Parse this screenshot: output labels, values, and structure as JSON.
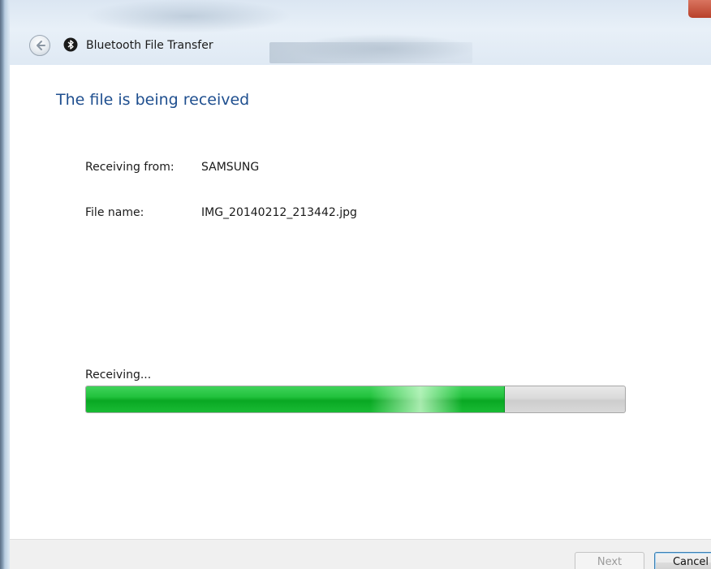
{
  "window": {
    "title": "Bluetooth File Transfer"
  },
  "icons": {
    "back": "back-arrow-icon",
    "bluetooth": "bluetooth-icon"
  },
  "main": {
    "heading": "The file is being received",
    "fields": [
      {
        "label": "Receiving from:",
        "value": "SAMSUNG"
      },
      {
        "label": "File name:",
        "value": "IMG_20140212_213442.jpg"
      }
    ],
    "progress": {
      "label": "Receiving...",
      "fraction": 0.775
    }
  },
  "footer": {
    "next_label": "Next",
    "cancel_label": "Cancel",
    "next_enabled": false
  },
  "colors": {
    "heading": "#1f4f8f",
    "progress_fill": "#22c23d",
    "progress_track": "#d6d6d6"
  }
}
